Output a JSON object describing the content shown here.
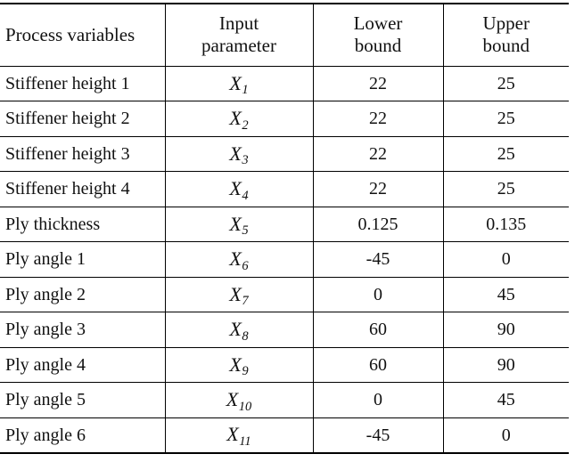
{
  "table": {
    "headers": [
      {
        "label": "Process variables",
        "align": "left"
      },
      {
        "label": "Input parameter",
        "line1": "Input",
        "line2": "parameter",
        "align": "center"
      },
      {
        "label": "Lower bound",
        "line1": "Lower",
        "line2": "bound",
        "align": "center"
      },
      {
        "label": "Upper bound",
        "line1": "Upper",
        "line2": "bound",
        "align": "center"
      }
    ],
    "rows": [
      {
        "process_variable": "Stiffener height 1",
        "symbol": "X",
        "subscript": "1",
        "lower_bound": "22",
        "upper_bound": "25"
      },
      {
        "process_variable": "Stiffener height 2",
        "symbol": "X",
        "subscript": "2",
        "lower_bound": "22",
        "upper_bound": "25"
      },
      {
        "process_variable": "Stiffener height 3",
        "symbol": "X",
        "subscript": "3",
        "lower_bound": "22",
        "upper_bound": "25"
      },
      {
        "process_variable": "Stiffener height 4",
        "symbol": "X",
        "subscript": "4",
        "lower_bound": "22",
        "upper_bound": "25"
      },
      {
        "process_variable": "Ply thickness",
        "symbol": "X",
        "subscript": "5",
        "lower_bound": "0.125",
        "upper_bound": "0.135"
      },
      {
        "process_variable": "Ply angle 1",
        "symbol": "X",
        "subscript": "6",
        "lower_bound": "-45",
        "upper_bound": "0"
      },
      {
        "process_variable": "Ply angle 2",
        "symbol": "X",
        "subscript": "7",
        "lower_bound": "0",
        "upper_bound": "45"
      },
      {
        "process_variable": "Ply angle 3",
        "symbol": "X",
        "subscript": "8",
        "lower_bound": "60",
        "upper_bound": "90"
      },
      {
        "process_variable": "Ply angle 4",
        "symbol": "X",
        "subscript": "9",
        "lower_bound": "60",
        "upper_bound": "90"
      },
      {
        "process_variable": "Ply angle 5",
        "symbol": "X",
        "subscript": "10",
        "lower_bound": "0",
        "upper_bound": "45"
      },
      {
        "process_variable": "Ply angle 6",
        "symbol": "X",
        "subscript": "11",
        "lower_bound": "-45",
        "upper_bound": "0"
      }
    ]
  },
  "style": {
    "rule_color": "#000000",
    "text_color": "#111111",
    "background": "#ffffff"
  }
}
